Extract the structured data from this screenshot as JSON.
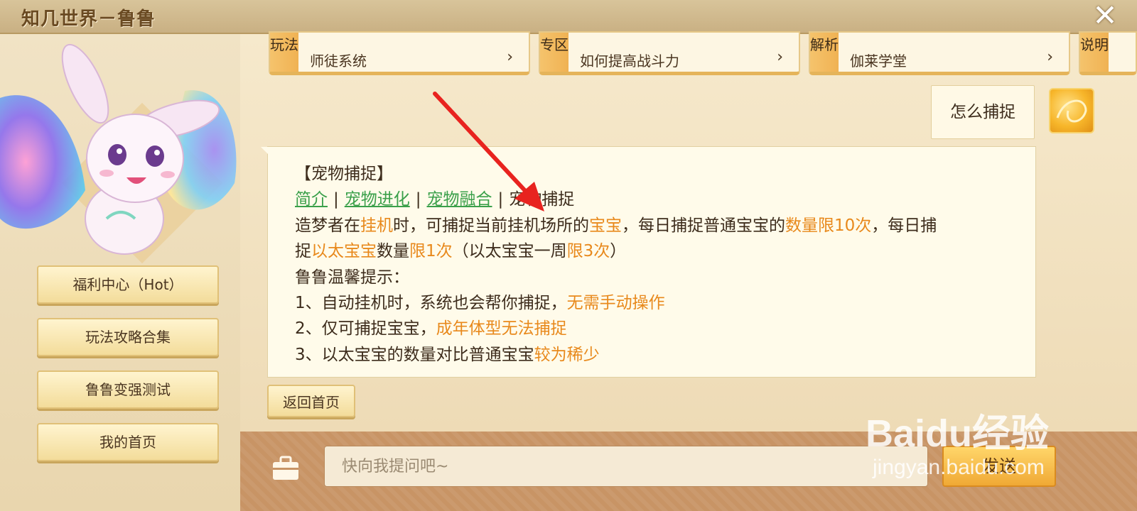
{
  "window": {
    "title": "知几世界－鲁鲁",
    "close_glyph": "✕"
  },
  "sidebar": {
    "buttons": [
      {
        "label": "福利中心（Hot）"
      },
      {
        "label": "玩法攻略合集"
      },
      {
        "label": "鲁鲁变强测试"
      },
      {
        "label": "我的首页"
      }
    ]
  },
  "top_cards": [
    {
      "tab": "玩法",
      "text": "师徒系统",
      "chevron": "›"
    },
    {
      "tab": "专区",
      "text": "如何提高战斗力",
      "chevron": "›"
    },
    {
      "tab": "解析",
      "text": "伽莱学堂",
      "chevron": "›"
    },
    {
      "tab": "说明",
      "text": "",
      "chevron": ""
    }
  ],
  "user_message": {
    "text": "怎么捕捉"
  },
  "answer": {
    "heading": "【宠物捕捉】",
    "links": [
      "简介",
      "宠物进化",
      "宠物融合"
    ],
    "current": "宠物捕捉",
    "separator": "|",
    "p1_a": "造梦者在",
    "p1_b": "挂机",
    "p1_c": "时，可捕捉当前挂机场所的",
    "p1_d": "宝宝",
    "p1_e": "，每日捕捉普通宝宝的",
    "p1_f": "数量限10次",
    "p1_g": "，每日捕",
    "p2_a": "捉",
    "p2_b": "以太宝宝",
    "p2_c": "数量",
    "p2_d": "限1次",
    "p2_e": "（以太宝宝一周",
    "p2_f": "限3次",
    "p2_g": "）",
    "tip_title": "鲁鲁温馨提示：",
    "tip1_a": "1、自动挂机时，系统也会帮你捕捉，",
    "tip1_b": "无需手动操作",
    "tip2_a": "2、仅可捕捉宝宝，",
    "tip2_b": "成年体型无法捕捉",
    "tip3_a": "3、以太宝宝的数量对比普通宝宝",
    "tip3_b": "较为稀少"
  },
  "back_button": {
    "label": "返回首页"
  },
  "input": {
    "placeholder": "快向我提问吧~",
    "value": ""
  },
  "send_button": {
    "label": "发送"
  },
  "watermark": {
    "brand": "Baidu经验",
    "url": "jingyan.baidu.com"
  },
  "colors": {
    "highlight": "#e8891c",
    "link": "#3aa04a",
    "arrow": "#e8231f"
  }
}
